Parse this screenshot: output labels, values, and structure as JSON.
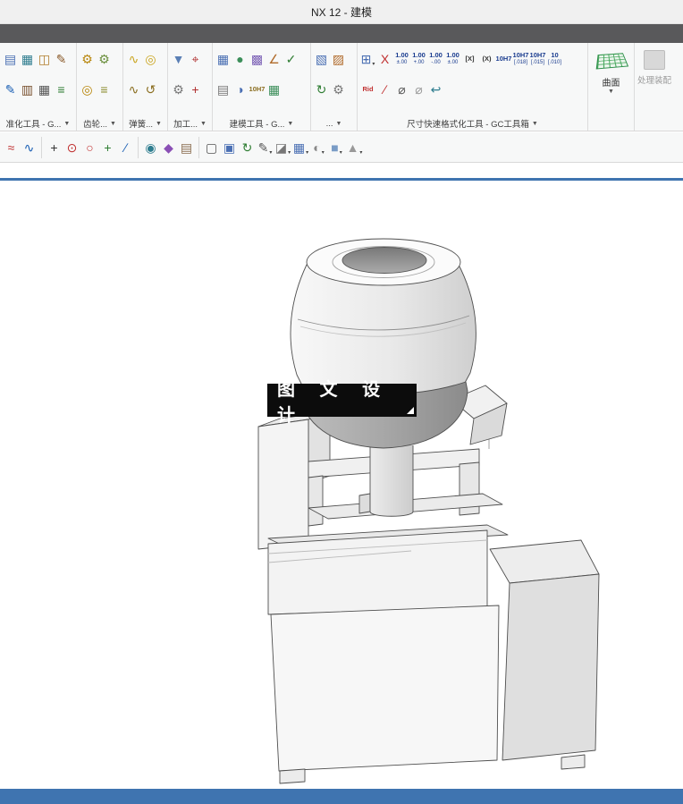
{
  "window": {
    "title": "NX 12 - 建模"
  },
  "colors": {
    "accent_blue": "#3f74b0",
    "dark_strip": "#59595b",
    "banner_bg": "#0c0c0c",
    "mesh_green": "#49a85f"
  },
  "ribbon": {
    "groups": {
      "g1": {
        "label": "准化工具 - G...",
        "row1": [
          {
            "name": "standard-parts-icon",
            "glyph": "▤",
            "color": "#4a6fb3"
          },
          {
            "name": "part-family-icon",
            "glyph": "▦",
            "color": "#2e7d8f"
          },
          {
            "name": "stamp-icon",
            "glyph": "◫",
            "color": "#b07c2a"
          },
          {
            "name": "edit-note-icon",
            "glyph": "✎",
            "color": "#8a5a2a"
          }
        ],
        "row2": [
          {
            "name": "pen-icon",
            "glyph": "✎",
            "color": "#1a5fb4"
          },
          {
            "name": "sheet-icon",
            "glyph": "▥",
            "color": "#7a5230"
          },
          {
            "name": "table-icon",
            "glyph": "▦",
            "color": "#555555"
          },
          {
            "name": "list-icon",
            "glyph": "≡",
            "color": "#2e7d32"
          }
        ]
      },
      "g2": {
        "label": "齿轮...",
        "row1": [
          {
            "name": "gear-pair-icon",
            "glyph": "⚙",
            "color": "#b8860b"
          },
          {
            "name": "gear-icon",
            "glyph": "⚙",
            "color": "#6a8f3c"
          }
        ],
        "row2": [
          {
            "name": "internal-gear-icon",
            "glyph": "◎",
            "color": "#b8860b"
          },
          {
            "name": "gear-rack-icon",
            "glyph": "≡",
            "color": "#8a8a2a"
          }
        ]
      },
      "g3": {
        "label": "弹簧...",
        "row1": [
          {
            "name": "spring-icon",
            "glyph": "∿",
            "color": "#caa520"
          },
          {
            "name": "coil-icon",
            "glyph": "◎",
            "color": "#caa520"
          }
        ],
        "row2": [
          {
            "name": "compression-spring-icon",
            "glyph": "∿",
            "color": "#8a6d1f"
          },
          {
            "name": "torsion-spring-icon",
            "glyph": "↺",
            "color": "#8a6d1f"
          }
        ]
      },
      "g4": {
        "label": "加工...",
        "row1": [
          {
            "name": "drill-icon",
            "glyph": "▼",
            "color": "#5a7fb5"
          },
          {
            "name": "target-icon",
            "glyph": "⌖",
            "color": "#b03030"
          }
        ],
        "row2": [
          {
            "name": "mill-icon",
            "glyph": "⚙",
            "color": "#777777"
          },
          {
            "name": "probe-icon",
            "glyph": "+",
            "color": "#b03030"
          }
        ]
      },
      "g5": {
        "label": "建模工具 - G...",
        "row1": [
          {
            "name": "block-icon",
            "glyph": "▦",
            "color": "#4a6fb3"
          },
          {
            "name": "sphere-icon",
            "glyph": "●",
            "color": "#3c8f5a"
          },
          {
            "name": "pattern-icon",
            "glyph": "▩",
            "color": "#7a5fb5"
          },
          {
            "name": "angle-measure-icon",
            "glyph": "∠",
            "color": "#b06a2a"
          },
          {
            "name": "check-icon",
            "glyph": "✓",
            "color": "#2e7d32"
          }
        ],
        "row2": [
          {
            "name": "notes-icon",
            "glyph": "▤",
            "color": "#777777"
          },
          {
            "name": "half-view-icon",
            "glyph": "◑",
            "color": "#4a6fb3"
          },
          {
            "name": "fit-tag-icon",
            "glyph": "10H7",
            "color": "#8a6d1f",
            "small": true
          },
          {
            "name": "grid-icon",
            "glyph": "▦",
            "color": "#3c8f5a"
          }
        ]
      },
      "g6": {
        "label": "...",
        "row1": [
          {
            "name": "data-import-icon",
            "glyph": "▧",
            "color": "#4a6fb3"
          },
          {
            "name": "data-export-icon",
            "glyph": "▨",
            "color": "#b06a2a"
          }
        ],
        "row2": [
          {
            "name": "refresh-icon",
            "glyph": "↻",
            "color": "#2e7d32"
          },
          {
            "name": "settings-icon",
            "glyph": "⚙",
            "color": "#777777"
          }
        ]
      },
      "g7": {
        "label": "尺寸快速格式化工具 - GC工具箱",
        "row1": [
          {
            "name": "dim-style-icon",
            "glyph": "⊞",
            "color": "#4a6fb3",
            "dropdown": true
          },
          {
            "name": "remove-tolerance-icon",
            "glyph": "X",
            "color": "#c03030"
          },
          {
            "name": "tolerance-plusminus-icon",
            "glyph": "1.00",
            "sub": "±.00",
            "color": "#1a3c8f"
          },
          {
            "name": "tolerance-upper-icon",
            "glyph": "1.00",
            "sub": "+.00",
            "color": "#1a3c8f"
          },
          {
            "name": "tolerance-lower-icon",
            "glyph": "1.00",
            "sub": "-.00",
            "color": "#1a3c8f"
          },
          {
            "name": "tolerance-limits-icon",
            "glyph": "1.00",
            "sub": "±.00",
            "color": "#1a3c8f"
          },
          {
            "name": "boxed-dim-icon",
            "glyph": "[X]",
            "color": "#333333",
            "small": true
          },
          {
            "name": "reference-dim-icon",
            "glyph": "(X)",
            "color": "#333333",
            "small": true
          },
          {
            "name": "fit-h7-icon",
            "glyph": "10H7",
            "color": "#1a3c8f",
            "small": true
          },
          {
            "name": "fit-h7-tol-icon",
            "glyph": "10H7",
            "sub": "[.018]",
            "color": "#1a3c8f"
          },
          {
            "name": "fit-h7-limits-icon",
            "glyph": "10H7",
            "sub": "[.015]",
            "color": "#1a3c8f"
          },
          {
            "name": "fit-10-icon",
            "glyph": "10",
            "sub": "[.010]",
            "color": "#1a3c8f"
          }
        ],
        "row2": [
          {
            "name": "rid-icon",
            "glyph": "Rid",
            "color": "#c03030",
            "small": true
          },
          {
            "name": "strike-dim-icon",
            "glyph": "∕",
            "color": "#c03030"
          },
          {
            "name": "diameter-icon",
            "glyph": "⌀",
            "color": "#555555"
          },
          {
            "name": "diameter-alt-icon",
            "glyph": "⌀",
            "color": "#999999"
          },
          {
            "name": "return-icon",
            "glyph": "↩",
            "color": "#2e7d8f"
          }
        ]
      }
    },
    "surface_panel": {
      "label": "曲面"
    },
    "assembly_button": {
      "label": "处理装配"
    }
  },
  "toolbar2": {
    "icons": [
      {
        "name": "fit-spline-icon",
        "glyph": "≈",
        "color": "#c03030"
      },
      {
        "name": "studio-spline-icon",
        "glyph": "∿",
        "color": "#1a5fb4"
      },
      {
        "sep": true
      },
      {
        "name": "point-icon",
        "glyph": "+",
        "color": "#333333"
      },
      {
        "name": "circle-center-icon",
        "glyph": "⊙",
        "color": "#c03030"
      },
      {
        "name": "ref-circle-icon",
        "glyph": "○",
        "color": "#c03030"
      },
      {
        "name": "plus-icon",
        "glyph": "+",
        "color": "#2e7d32"
      },
      {
        "name": "line-icon",
        "glyph": "∕",
        "color": "#1a5fb4"
      },
      {
        "sep": true
      },
      {
        "name": "surface-curve-icon",
        "glyph": "◉",
        "color": "#2e7d8f"
      },
      {
        "name": "gem-icon",
        "glyph": "◆",
        "color": "#8a4fb5"
      },
      {
        "name": "notebook-icon",
        "glyph": "▤",
        "color": "#8a6d4f"
      },
      {
        "sep": true
      },
      {
        "name": "window-select-icon",
        "glyph": "▢",
        "color": "#555555"
      },
      {
        "name": "snapshot-icon",
        "glyph": "▣",
        "color": "#4a6fb3"
      },
      {
        "name": "rotate-view-icon",
        "glyph": "↻",
        "color": "#2e7d32"
      },
      {
        "name": "pencil-tool-icon",
        "glyph": "✎",
        "color": "#555555",
        "dropdown": true
      },
      {
        "name": "erase-tool-icon",
        "glyph": "◪",
        "color": "#777777",
        "dropdown": true
      },
      {
        "name": "layout-icon",
        "glyph": "▦",
        "color": "#4a6fb3",
        "dropdown": true
      },
      {
        "name": "shaded-face-icon",
        "glyph": "◐",
        "color": "#888888",
        "dropdown": true
      },
      {
        "name": "solid-cube-icon",
        "glyph": "■",
        "color": "#7a9cc6",
        "dropdown": true
      },
      {
        "name": "cone-icon",
        "glyph": "▲",
        "color": "#999999",
        "dropdown": true
      }
    ]
  },
  "viewport": {
    "watermark": "图 文 设 计"
  }
}
